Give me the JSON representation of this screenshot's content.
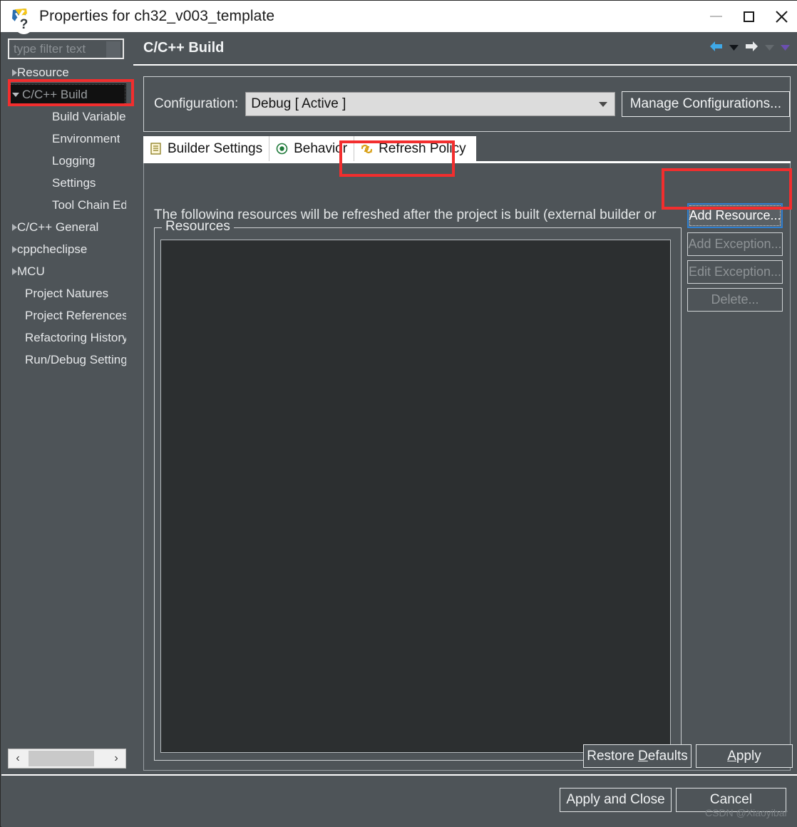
{
  "window": {
    "title": "Properties for ch32_v003_template",
    "app_icon": "eclipse-mcu-icon",
    "controls": {
      "minimize": "minimize-icon",
      "maximize": "maximize-icon",
      "close": "close-icon"
    }
  },
  "sidebar": {
    "filter": {
      "placeholder": "type filter text",
      "value": ""
    },
    "scrollbar": {
      "left_arrow": "‹",
      "right_arrow": "›"
    },
    "items": [
      {
        "label": "Resource",
        "level": 0,
        "expandable": true,
        "expanded": false,
        "selected": false
      },
      {
        "label": "C/C++ Build",
        "level": 0,
        "expandable": true,
        "expanded": true,
        "selected": true
      },
      {
        "label": "Build Variables",
        "level": 1,
        "expandable": false,
        "expanded": false,
        "selected": false
      },
      {
        "label": "Environment",
        "level": 1,
        "expandable": false,
        "expanded": false,
        "selected": false
      },
      {
        "label": "Logging",
        "level": 1,
        "expandable": false,
        "expanded": false,
        "selected": false
      },
      {
        "label": "Settings",
        "level": 1,
        "expandable": false,
        "expanded": false,
        "selected": false
      },
      {
        "label": "Tool Chain Editor",
        "level": 1,
        "expandable": false,
        "expanded": false,
        "selected": false
      },
      {
        "label": "C/C++ General",
        "level": 0,
        "expandable": true,
        "expanded": false,
        "selected": false
      },
      {
        "label": "cppcheclipse",
        "level": 0,
        "expandable": true,
        "expanded": false,
        "selected": false
      },
      {
        "label": "MCU",
        "level": 0,
        "expandable": true,
        "expanded": false,
        "selected": false
      },
      {
        "label": "Project Natures",
        "level": 0,
        "expandable": false,
        "expanded": false,
        "selected": false
      },
      {
        "label": "Project References",
        "level": 0,
        "expandable": false,
        "expanded": false,
        "selected": false
      },
      {
        "label": "Refactoring History",
        "level": 0,
        "expandable": false,
        "expanded": false,
        "selected": false
      },
      {
        "label": "Run/Debug Settings",
        "level": 0,
        "expandable": false,
        "expanded": false,
        "selected": false
      }
    ]
  },
  "page": {
    "title": "C/C++ Build",
    "nav": {
      "back_icon": "back-arrow-icon",
      "back_menu_icon": "chevron-down-icon",
      "forward_icon": "forward-arrow-icon",
      "forward_menu_icon": "chevron-down-icon",
      "view_menu_icon": "chevron-down-icon"
    },
    "configuration": {
      "label": "Configuration:",
      "selected": "Debug  [ Active ]",
      "options": [
        "Debug  [ Active ]"
      ],
      "manage_button": "Manage Configurations..."
    },
    "tabs": [
      {
        "label": "Builder Settings",
        "icon": "builder-settings-icon",
        "active": false
      },
      {
        "label": "Behavior",
        "icon": "behavior-target-icon",
        "active": false
      },
      {
        "label": "Refresh Policy",
        "icon": "refresh-policy-icon",
        "active": true
      }
    ],
    "refresh_policy": {
      "description": "The following resources will be refreshed after the project is built (external builder or",
      "group_label": "Resources",
      "resources": [],
      "buttons": [
        {
          "label": "Add Resource...",
          "enabled": true,
          "focused": true
        },
        {
          "label": "Add Exception...",
          "enabled": false,
          "focused": false
        },
        {
          "label": "Edit Exception...",
          "enabled": false,
          "focused": false
        },
        {
          "label": "Delete...",
          "enabled": false,
          "focused": false
        }
      ]
    },
    "restore_defaults_button": "Restore Defaults",
    "apply_button": "Apply"
  },
  "footer": {
    "help_icon": "help-question-icon",
    "help_glyph": "?",
    "apply_and_close_button": "Apply and Close",
    "cancel_button": "Cancel",
    "watermark": "CSDN @Xiaoyibar"
  },
  "annotations": {
    "color": "#f22e2e",
    "boxes": [
      "tree-item-cpp-build",
      "tab-refresh-policy",
      "add-resource-button"
    ]
  }
}
